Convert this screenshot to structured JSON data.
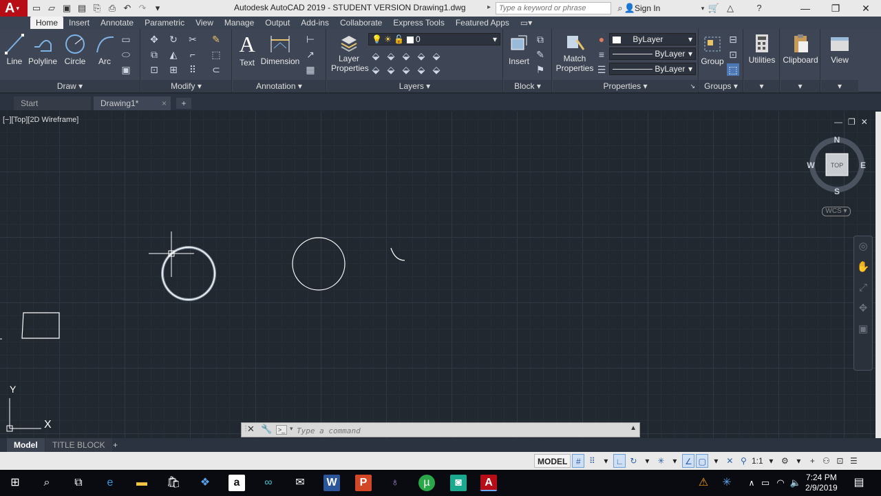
{
  "window": {
    "app_letter": "A",
    "title": "Autodesk AutoCAD 2019 - STUDENT VERSION    Drawing1.dwg",
    "search_placeholder": "Type a keyword or phrase",
    "sign_in": "Sign In"
  },
  "ribbon_tabs": [
    "Home",
    "Insert",
    "Annotate",
    "Parametric",
    "View",
    "Manage",
    "Output",
    "Add-ins",
    "Collaborate",
    "Express Tools",
    "Featured Apps"
  ],
  "ribbon": {
    "draw": {
      "footer": "Draw",
      "line": "Line",
      "polyline": "Polyline",
      "circle": "Circle",
      "arc": "Arc"
    },
    "modify": {
      "footer": "Modify"
    },
    "annotation": {
      "footer": "Annotation",
      "text": "Text",
      "dimension": "Dimension"
    },
    "layers": {
      "footer": "Layers",
      "layer_properties_1": "Layer",
      "layer_properties_2": "Properties",
      "current_layer": "0"
    },
    "block": {
      "footer": "Block",
      "insert": "Insert"
    },
    "properties": {
      "footer": "Properties",
      "match_1": "Match",
      "match_2": "Properties",
      "color": "ByLayer",
      "linetype": "ByLayer",
      "lineweight": "ByLayer"
    },
    "groups": {
      "footer": "Groups",
      "group": "Group"
    },
    "utilities": "Utilities",
    "clipboard": "Clipboard",
    "view": "View"
  },
  "file_tabs": {
    "start": "Start",
    "drawing": "Drawing1*",
    "close": "×",
    "add": "+"
  },
  "viewport": {
    "label": "[−][Top][2D Wireframe]",
    "viewcube": {
      "n": "N",
      "s": "S",
      "e": "E",
      "w": "W",
      "top": "TOP"
    },
    "wcs": "WCS",
    "ucs_x": "X",
    "ucs_y": "Y"
  },
  "command_line": {
    "placeholder": "Type a command",
    "prompt_icon": ">_"
  },
  "layout_tabs": {
    "model": "Model",
    "title_block": "TITLE BLOCK",
    "add": "+"
  },
  "status": {
    "model": "MODEL",
    "scale": "1:1"
  },
  "taskbar": {
    "time": "7:24 PM",
    "date": "2/9/2019"
  },
  "icons": {
    "search": "search-icon",
    "gear": "gear-icon",
    "help": "help-icon"
  },
  "colors": {
    "accent": "#b70d16",
    "canvas": "#212830",
    "ribbon": "#3e4655",
    "highlight": "#2b5ea8"
  }
}
